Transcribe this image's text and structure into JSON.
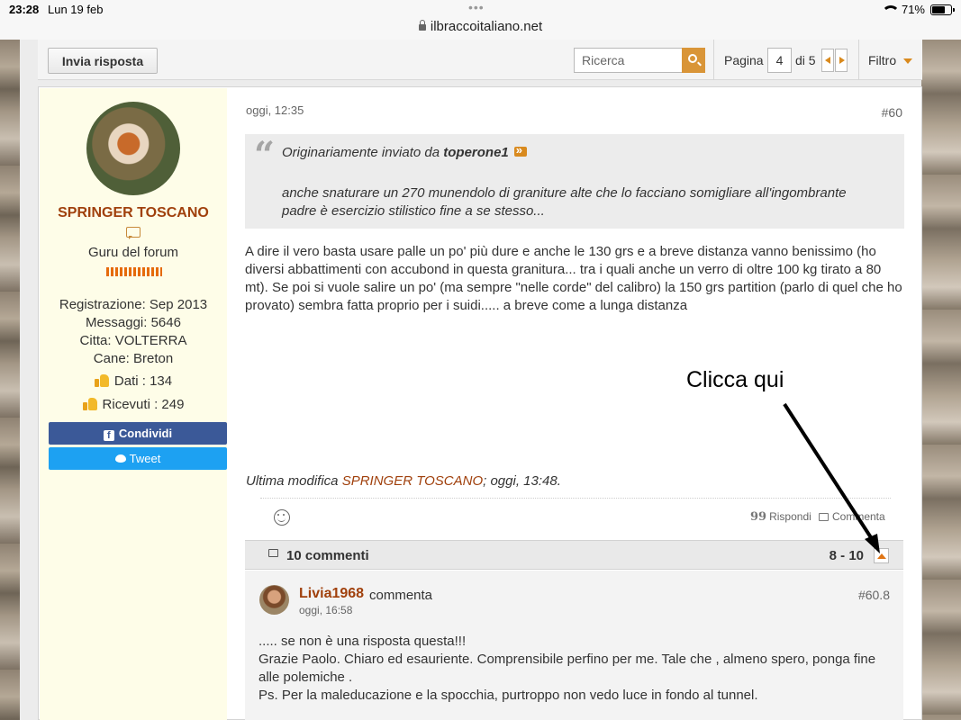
{
  "status_bar": {
    "time": "23:28",
    "date": "Lun 19 feb",
    "url": "ilbraccoitaliano.net",
    "battery": "71%",
    "battery_level": 0.71
  },
  "toolbar": {
    "reply_label": "Invia risposta",
    "search_placeholder": "Ricerca",
    "page_label": "Pagina",
    "page_current": "4",
    "page_of": "di 5",
    "filter_label": "Filtro"
  },
  "user": {
    "name": "SPRINGER TOSCANO",
    "rank": "Guru del forum",
    "registration": "Registrazione: Sep 2013",
    "messages": "Messaggi: 5646",
    "city": "Citta: VOLTERRA",
    "dog": "Cane: Breton",
    "likes_given": "Dati : 134",
    "likes_received": "Ricevuti : 249",
    "share_facebook": "Condividi",
    "share_tweet": "Tweet"
  },
  "post": {
    "date": "oggi, 12:35",
    "number": "#60",
    "quote_prefix": "Originariamente inviato da",
    "quote_author": "toperone1",
    "quote_text": "anche snaturare un 270 munendolo di graniture alte che lo facciano somigliare all'ingombrante padre è esercizio stilistico fine a se stesso...",
    "body": "A dire il vero basta usare palle un po' più dure e anche le 130 grs e a breve distanza vanno benissimo (ho diversi abbattimenti con accubond in questa granitura... tra i quali anche un verro di oltre 100 kg tirato a 80 mt). Se poi si vuole salire un po' (ma sempre \"nelle corde\" del calibro) la 150 grs partition (parlo di quel che ho provato) sembra fatta proprio per i suidi..... a breve come a lunga distanza",
    "edit_prefix": "Ultima modifica",
    "edit_user": "SPRINGER TOSCANO",
    "edit_suffix": "; oggi, 13:48.",
    "reply_label": "Rispondi",
    "comment_label": "Commenta"
  },
  "comments_bar": {
    "title": "10 commenti",
    "range": "8 - 10"
  },
  "comment": {
    "user": "Livia1968",
    "verb": "commenta",
    "time": "oggi, 16:58",
    "number": "#60.8",
    "line1": "..... se non è una risposta questa!!!",
    "line2": "Grazie Paolo. Chiaro ed esauriente. Comprensibile perfino per me. Tale che , almeno spero, ponga fine alle polemiche .",
    "line3": "Ps. Per la maleducazione e la spocchia, purtroppo non vedo luce in fondo al tunnel."
  },
  "annotation": {
    "text": "Clicca qui"
  },
  "colors": {
    "accent_orange": "#d98a1e",
    "username_red": "#a0400c",
    "facebook": "#3b5998",
    "twitter": "#1da1f2"
  }
}
